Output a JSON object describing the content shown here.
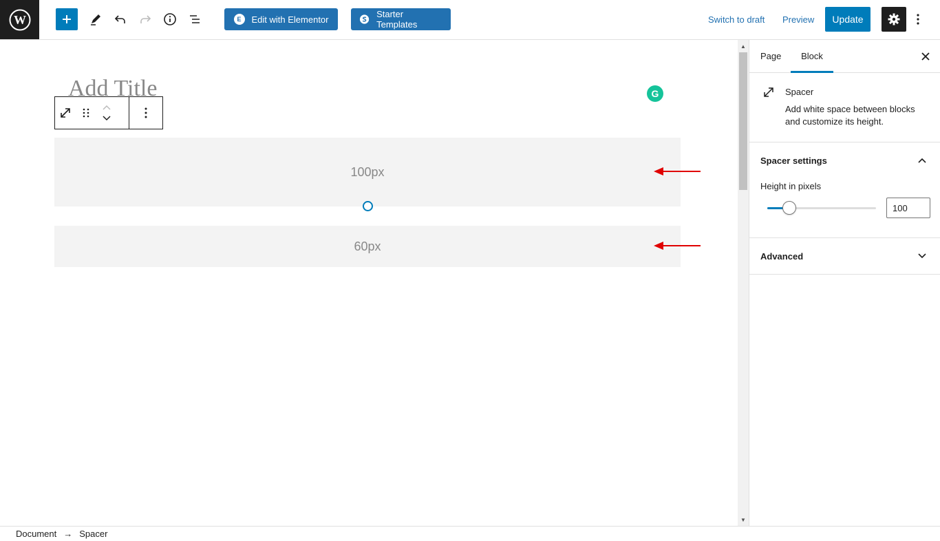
{
  "toolbar": {
    "edit_elementor": "Edit with Elementor",
    "starter_templates": "Starter Templates",
    "switch_draft": "Switch to draft",
    "preview": "Preview",
    "update": "Update"
  },
  "editor": {
    "title_placeholder": "Add Title",
    "spacers": [
      {
        "label": "100px"
      },
      {
        "label": "60px"
      }
    ]
  },
  "sidebar": {
    "tabs": [
      {
        "label": "Page"
      },
      {
        "label": "Block"
      }
    ],
    "active_tab": "Block",
    "block": {
      "name": "Spacer",
      "description": "Add white space between blocks and customize its height."
    },
    "spacer_settings": {
      "title": "Spacer settings",
      "height_label": "Height in pixels",
      "height_value": "100",
      "slider_fraction": 0.2
    },
    "advanced": {
      "title": "Advanced"
    }
  },
  "breadcrumb": {
    "items": [
      "Document",
      "Spacer"
    ],
    "separator": "→"
  },
  "colors": {
    "accent": "#007cba",
    "elementor_blue": "#2271b1",
    "annotation_arrow": "#e00000",
    "grammarly": "#15c39a"
  }
}
